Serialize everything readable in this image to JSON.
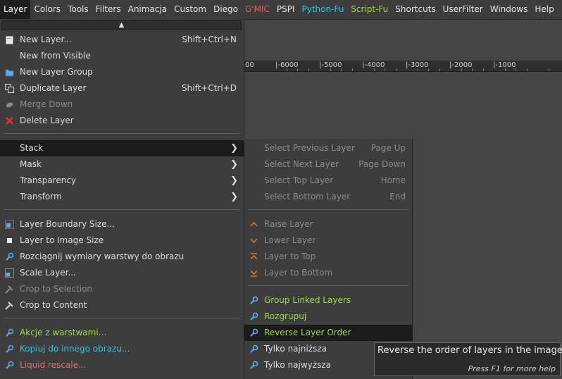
{
  "menubar": {
    "items": [
      {
        "label": "Layer",
        "color": "#ffffff"
      },
      {
        "label": "Colors",
        "color": "#e6e6e6"
      },
      {
        "label": "Tools",
        "color": "#e6e6e6"
      },
      {
        "label": "Filters",
        "color": "#e6e6e6"
      },
      {
        "label": "Animacja",
        "color": "#e6e6e6"
      },
      {
        "label": "Custom",
        "color": "#e6e6e6"
      },
      {
        "label": "Diego",
        "color": "#e6e6e6"
      },
      {
        "label": "G'MIC",
        "color": "#e06060"
      },
      {
        "label": "PSPI",
        "color": "#e6e6e6"
      },
      {
        "label": "Python-Fu",
        "color": "#33c6e0"
      },
      {
        "label": "Script-Fu",
        "color": "#9dd84a"
      },
      {
        "label": "Shortcuts",
        "color": "#e6e6e6"
      },
      {
        "label": "UserFilter",
        "color": "#e6e6e6"
      },
      {
        "label": "Windows",
        "color": "#e6e6e6"
      },
      {
        "label": "Help",
        "color": "#e6e6e6"
      }
    ]
  },
  "ruler": {
    "labels": [
      "00",
      "|-6000",
      "|-5000",
      "|-4000",
      "|-3000",
      "|-2000",
      "|-1000"
    ]
  },
  "layer_menu": {
    "scroll_up_glyph": "▲",
    "items": {
      "new_layer": {
        "label": "New Layer...",
        "shortcut": "Shift+Ctrl+N",
        "icon": "new-layer-icon"
      },
      "new_from_visible": {
        "label": "New from Visible"
      },
      "new_layer_group": {
        "label": "New Layer Group",
        "icon": "layer-group-icon"
      },
      "duplicate_layer": {
        "label": "Duplicate Layer",
        "shortcut": "Shift+Ctrl+D",
        "icon": "duplicate-icon"
      },
      "merge_down": {
        "label": "Merge Down",
        "icon": "merge-down-icon"
      },
      "delete_layer": {
        "label": "Delete Layer",
        "icon": "delete-icon"
      },
      "stack": {
        "label": "Stack"
      },
      "mask": {
        "label": "Mask"
      },
      "transparency": {
        "label": "Transparency"
      },
      "transform": {
        "label": "Transform"
      },
      "layer_boundary_size": {
        "label": "Layer Boundary Size...",
        "icon": "boundary-size-icon"
      },
      "layer_to_image_size": {
        "label": "Layer to Image Size",
        "icon": "to-image-size-icon"
      },
      "rozciagnij": {
        "label": "Rozciągnij wymiary warstwy do obrazu",
        "icon": "script-icon"
      },
      "scale_layer": {
        "label": "Scale Layer...",
        "icon": "scale-icon"
      },
      "crop_to_selection": {
        "label": "Crop to Selection",
        "icon": "crop-icon"
      },
      "crop_to_content": {
        "label": "Crop to Content",
        "icon": "crop-icon"
      },
      "akcje": {
        "label": "Akcje z warstwami...",
        "icon": "script-icon"
      },
      "kopiuj": {
        "label": "Kopiuj do innego obrazu...",
        "icon": "script-icon"
      },
      "liquid_rescale": {
        "label": "Liquid rescale...",
        "icon": "script-icon"
      }
    },
    "colors": {
      "green": "#9dd84a",
      "cyan": "#33c6e0",
      "red": "#e07070",
      "disabled": "#8a8a8a"
    }
  },
  "stack_submenu": {
    "items": {
      "select_previous": {
        "label": "Select Previous Layer",
        "shortcut": "Page Up"
      },
      "select_next": {
        "label": "Select Next Layer",
        "shortcut": "Page Down"
      },
      "select_top": {
        "label": "Select Top Layer",
        "shortcut": "Home"
      },
      "select_bottom": {
        "label": "Select Bottom Layer",
        "shortcut": "End"
      },
      "raise_layer": {
        "label": "Raise Layer",
        "icon": "raise-icon"
      },
      "lower_layer": {
        "label": "Lower Layer",
        "icon": "lower-icon"
      },
      "layer_to_top": {
        "label": "Layer to Top",
        "icon": "to-top-icon"
      },
      "layer_to_bottom": {
        "label": "Layer to Bottom",
        "icon": "to-bottom-icon"
      },
      "group_linked": {
        "label": "Group Linked Layers",
        "icon": "script-icon"
      },
      "rozgrupuj": {
        "label": "Rozgrupuj",
        "icon": "script-icon"
      },
      "reverse_order": {
        "label": "Reverse Layer Order",
        "icon": "script-icon"
      },
      "tylko_najnizsza": {
        "label": "Tylko najniższa",
        "icon": "script-icon"
      },
      "tylko_najwyzsza": {
        "label": "Tylko najwyższa",
        "icon": "script-icon"
      }
    }
  },
  "tooltip": {
    "text": "Reverse the order of layers in the image",
    "help": "Press F1 for more help"
  }
}
